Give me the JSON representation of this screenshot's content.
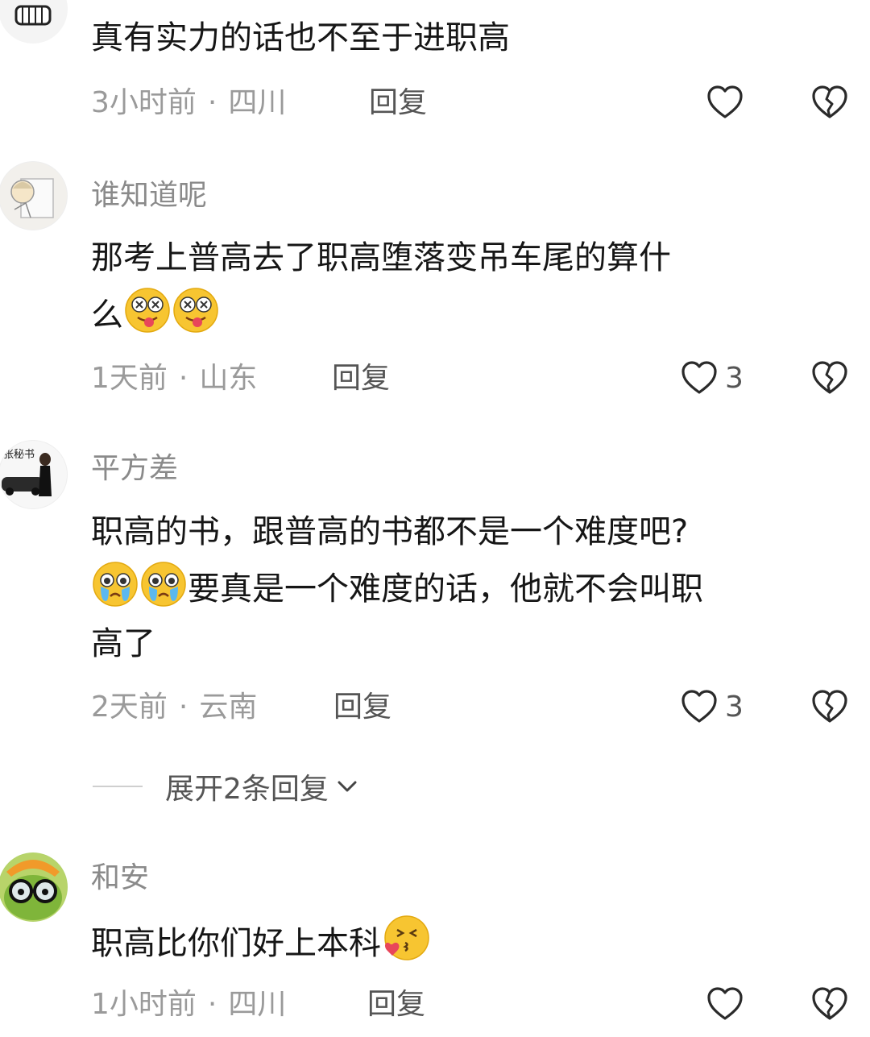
{
  "comments": [
    {
      "username": "",
      "text": "真有实力的话也不至于进职高",
      "time": "3小时前",
      "location": "四川",
      "reply_label": "回复",
      "likes": ""
    },
    {
      "username": "谁知道呢",
      "text_line1": "那考上普高去了职高堕落变吊车尾的算什",
      "text_line2": "么",
      "time": "1天前",
      "location": "山东",
      "reply_label": "回复",
      "likes": "3"
    },
    {
      "username": "平方差",
      "avatar_text": "张秘书",
      "text_line1": "职高的书，跟普高的书都不是一个难度吧?",
      "text_line2": "要真是一个难度的话，他就不会叫职",
      "text_line3": "高了",
      "time": "2天前",
      "location": "云南",
      "reply_label": "回复",
      "likes": "3",
      "expand_label": "展开2条回复"
    },
    {
      "username": "和安",
      "text": "职高比你们好上本科",
      "time": "1小时前",
      "location": "四川",
      "reply_label": "回复",
      "likes": ""
    }
  ],
  "icons": {
    "like": "heart-outline-icon",
    "dislike": "broken-heart-icon",
    "expand": "chevron-down-icon"
  },
  "colors": {
    "text": "#161616",
    "meta": "#9a9a9a",
    "emoji_yellow": "#f7c531"
  }
}
